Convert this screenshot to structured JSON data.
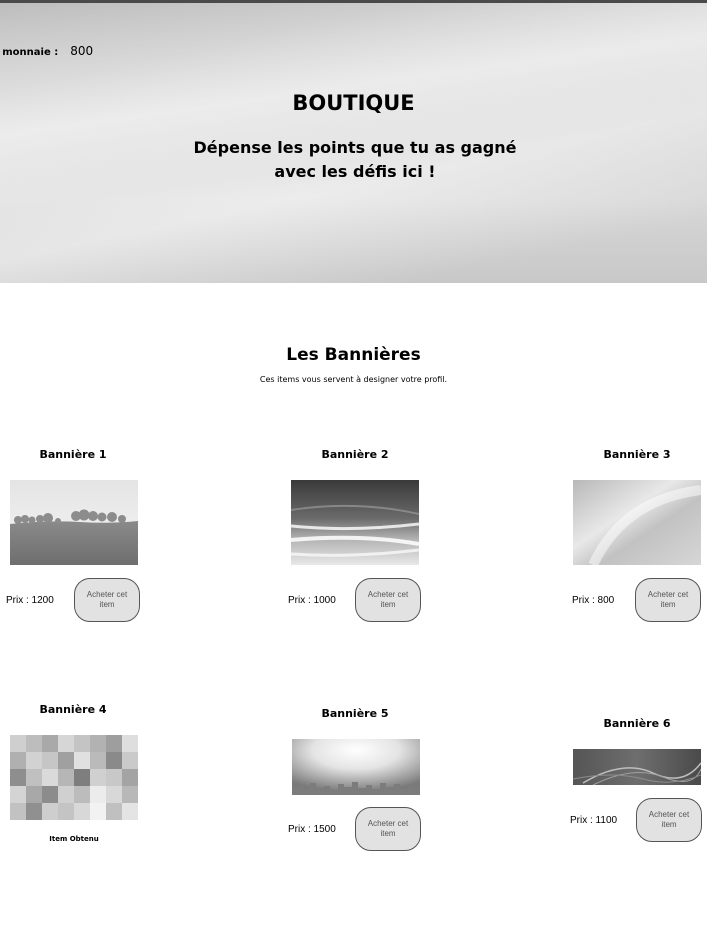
{
  "header": {
    "currency_label": "e monnaie :",
    "currency_value": "800",
    "title": "BOUTIQUE",
    "subtitle": "Dépense les points que tu as gagné avec les défis ici !"
  },
  "section": {
    "title": "Les Bannières",
    "subtitle": "Ces items vous servent à designer votre profil."
  },
  "items": [
    {
      "title": "Bannière 1",
      "price": "Prix : 1200",
      "button": "Acheter cet item"
    },
    {
      "title": "Bannière 2",
      "price": "Prix : 1000",
      "button": "Acheter cet item"
    },
    {
      "title": "Bannière 3",
      "price": "Prix : 800",
      "button": "Acheter cet item"
    },
    {
      "title": "Bannière 4",
      "status": "Item Obtenu"
    },
    {
      "title": "Bannière 5",
      "price": "Prix : 1500",
      "button": "Acheter cet item"
    },
    {
      "title": "Bannière 6",
      "price": "Prix : 1100",
      "button": "Acheter cet item"
    }
  ]
}
